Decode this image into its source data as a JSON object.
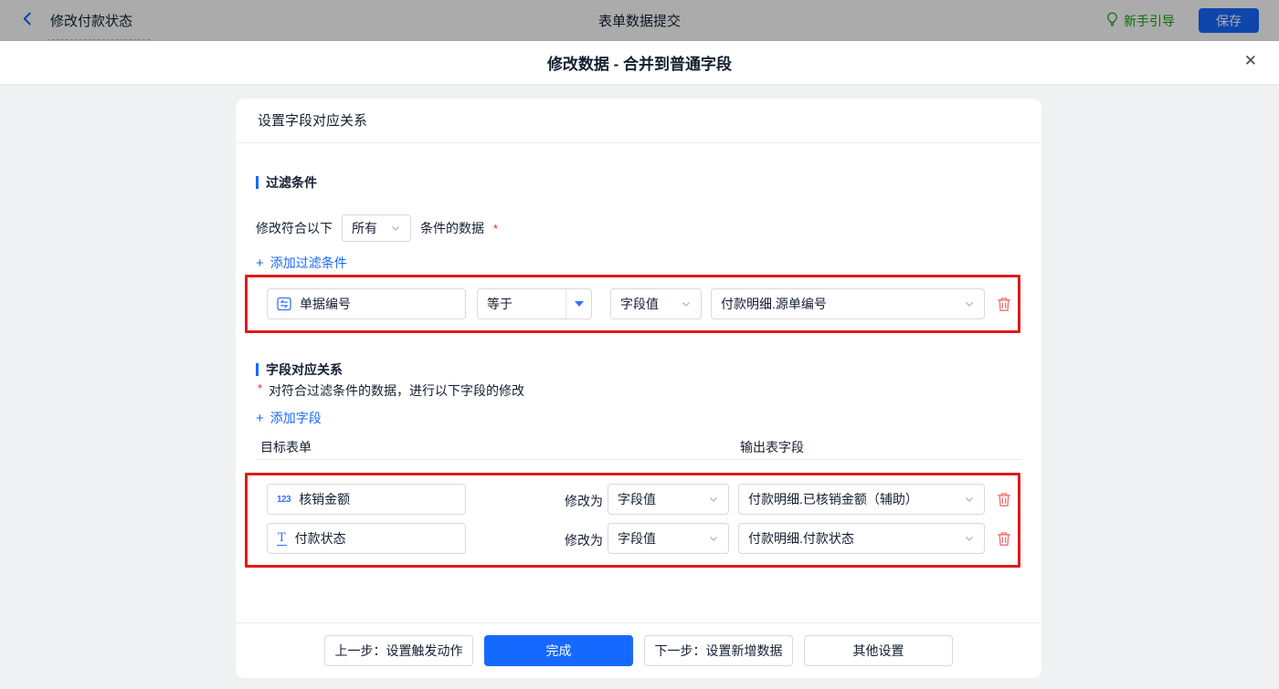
{
  "topbar": {
    "title": "修改付款状态",
    "center_title": "表单数据提交",
    "guide_label": "新手引导",
    "save_label": "保存"
  },
  "dialog": {
    "title": "修改数据 - 合并到普通字段",
    "close_icon": "✕"
  },
  "panel": {
    "header": "设置字段对应关系",
    "filter": {
      "section_title": "过滤条件",
      "condition_prefix": "修改符合以下",
      "match_value": "所有",
      "condition_suffix": "条件的数据",
      "required_mark": "*",
      "plus_icon": "+",
      "add_label": "添加过滤条件",
      "row": {
        "field": "单据编号",
        "operator": "等于",
        "value_type": "字段值",
        "value": "付款明细.源单编号"
      }
    },
    "mapping": {
      "section_title": "字段对应关系",
      "required_mark": "*",
      "description": "对符合过滤条件的数据，进行以下字段的修改",
      "plus_icon": "+",
      "add_label": "添加字段",
      "col_target": "目标表单",
      "col_output": "输出表字段",
      "rows": [
        {
          "icon_glyph": "123",
          "field": "核销金额",
          "modify_label": "修改为",
          "value_type": "字段值",
          "output": "付款明细.已核销金额（辅助）"
        },
        {
          "icon_glyph": "T",
          "field": "付款状态",
          "modify_label": "修改为",
          "value_type": "字段值",
          "output": "付款明细.付款状态"
        }
      ]
    },
    "footer": {
      "prev": "上一步：设置触发动作",
      "done": "完成",
      "next": "下一步：设置新增数据",
      "other": "其他设置"
    }
  },
  "colors": {
    "accent_blue": "#1669ff",
    "icon_blue": "#3370ff",
    "annotation_red": "#e01a1a",
    "trash_red": "#f46c6c",
    "guide_green": "#0fa30f",
    "asterisk_red": "#f5222d"
  }
}
